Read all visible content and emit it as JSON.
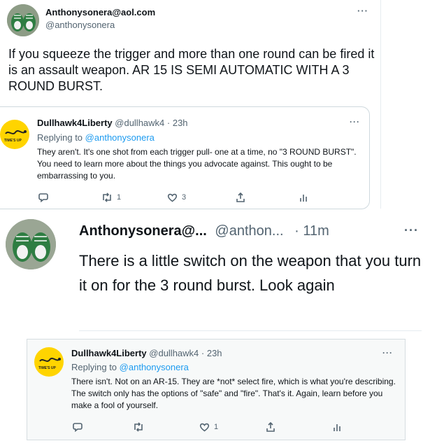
{
  "tweet1": {
    "display_name": "Anthonysonera@aol.com",
    "handle": "@anthonysonera",
    "more": "···",
    "text": "If you squeeze the trigger and more than one round can be fired it is an assault weapon. AR 15 IS SEMI AUTOMATIC WITH A 3 ROUND BURST."
  },
  "reply1": {
    "display_name": "Dullhawk4Liberty",
    "handle": "@dullhawk4",
    "time": "· 23h",
    "replying_prefix": "Replying to",
    "replying_handle": "@anthonysonera",
    "text": "They aren't. It's one shot from each trigger pull- one at a time, no \"3 ROUND BURST\". You need to learn more about the things you advocate against. This ought to be embarrassing to you.",
    "more": "···",
    "logo_text": "TIME'S UP",
    "actions": {
      "reply_count": "",
      "retweet_count": "1",
      "like_count": "3"
    }
  },
  "tweet2": {
    "display_name": "Anthonysonera@...",
    "handle": "@anthon...",
    "time": "· 11m",
    "more": "···",
    "text": "There is a little switch on the weapon that you turn it on for the 3 round burst. Look again"
  },
  "reply2": {
    "display_name": "Dullhawk4Liberty",
    "handle": "@dullhawk4",
    "time": "· 23h",
    "replying_prefix": "Replying to",
    "replying_handle": "@anthonysonera",
    "text": "There isn't. Not on an AR-15. They are *not* select fire, which is what you're describing. The switch only has the options of \"safe\" and \"fire\". That's it. Again, learn before you make a fool of yourself.",
    "more": "···",
    "logo_text": "TIME'S UP",
    "actions": {
      "reply_count": "",
      "retweet_count": "",
      "like_count": "1"
    }
  },
  "colors": {
    "link": "#1d9bf0",
    "muted": "#536471",
    "border": "#cfd9de",
    "logo": "#ffd400"
  }
}
